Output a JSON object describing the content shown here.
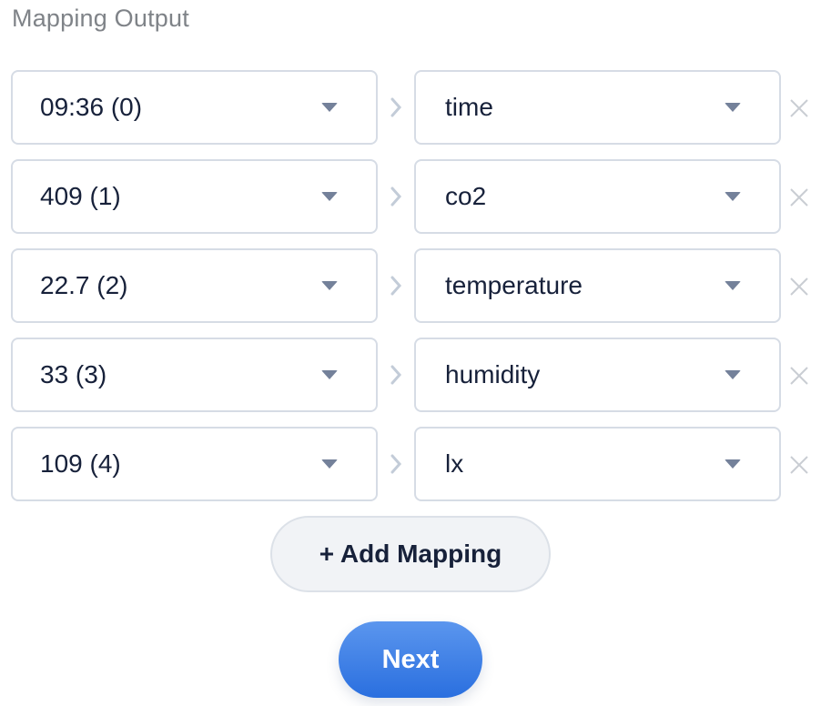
{
  "title": "Mapping Output",
  "mappings": [
    {
      "source": "09:36 (0)",
      "target": "time"
    },
    {
      "source": "409 (1)",
      "target": "co2"
    },
    {
      "source": "22.7 (2)",
      "target": "temperature"
    },
    {
      "source": "33 (3)",
      "target": "humidity"
    },
    {
      "source": "109 (4)",
      "target": "lx"
    }
  ],
  "icons": {
    "dropdown": "caret-down",
    "arrow": "chevron-right",
    "remove": "close-x"
  },
  "colors": {
    "accent": "#2a6fdf",
    "text": "#17213a",
    "muted": "#7f8388",
    "border": "#d6dce5"
  },
  "buttons": {
    "add_mapping": "+ Add Mapping",
    "next": "Next"
  }
}
